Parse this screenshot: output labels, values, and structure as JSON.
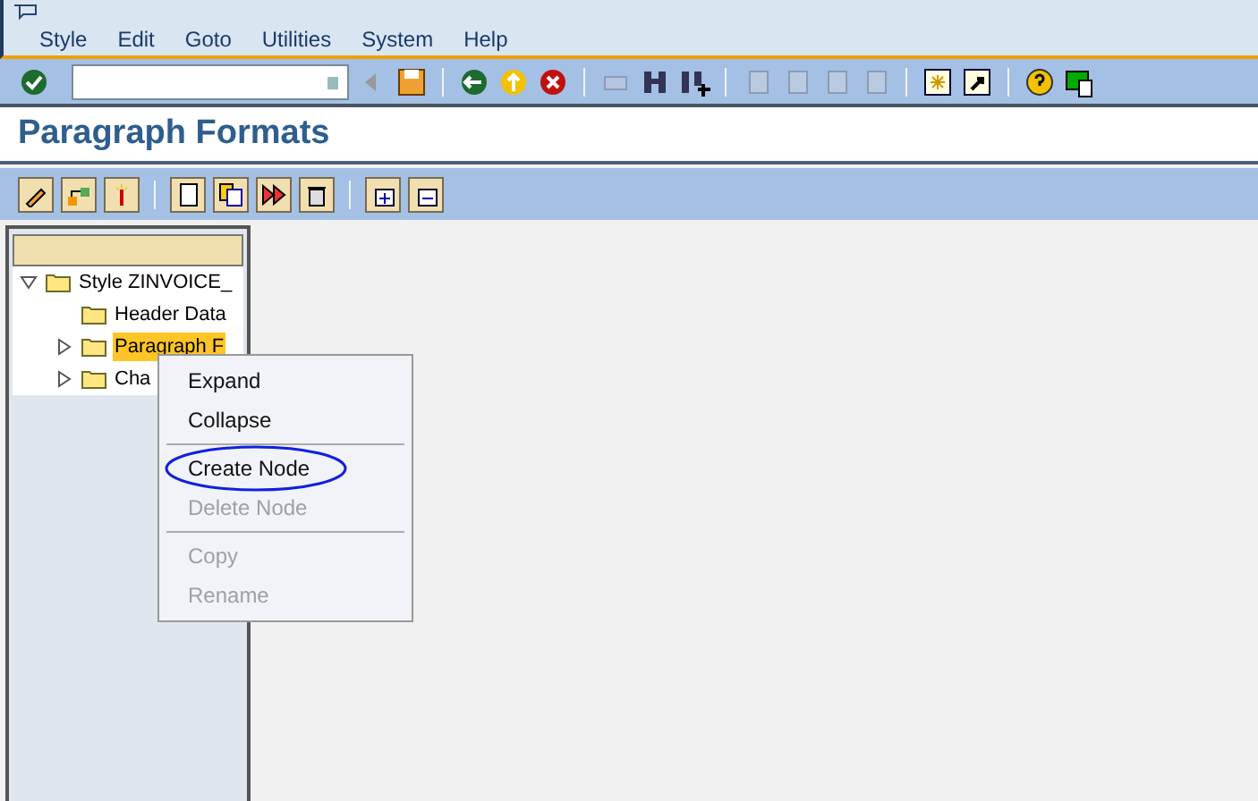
{
  "menu_bar": [
    "Style",
    "Edit",
    "Goto",
    "Utilities",
    "System",
    "Help"
  ],
  "title": "Paragraph Formats",
  "tree": [
    {
      "label": "Style ZINVOICE_",
      "expanded": true,
      "selected": false,
      "leaf": false,
      "children": [
        {
          "label": "Header Data",
          "expanded": false,
          "selected": false,
          "leaf": true
        },
        {
          "label": "Paragraph F",
          "expanded": false,
          "selected": true,
          "leaf": false
        },
        {
          "label": "Cha",
          "expanded": false,
          "selected": false,
          "leaf": false
        }
      ]
    }
  ],
  "context_menu": [
    [
      {
        "label": "Expand",
        "disabled": false,
        "circled": false
      },
      {
        "label": "Collapse",
        "disabled": false,
        "circled": false
      }
    ],
    [
      {
        "label": "Create Node",
        "disabled": false,
        "circled": true
      },
      {
        "label": "Delete Node",
        "disabled": true,
        "circled": false
      }
    ],
    [
      {
        "label": "Copy",
        "disabled": true,
        "circled": false
      },
      {
        "label": "Rename",
        "disabled": true,
        "circled": false
      }
    ]
  ]
}
